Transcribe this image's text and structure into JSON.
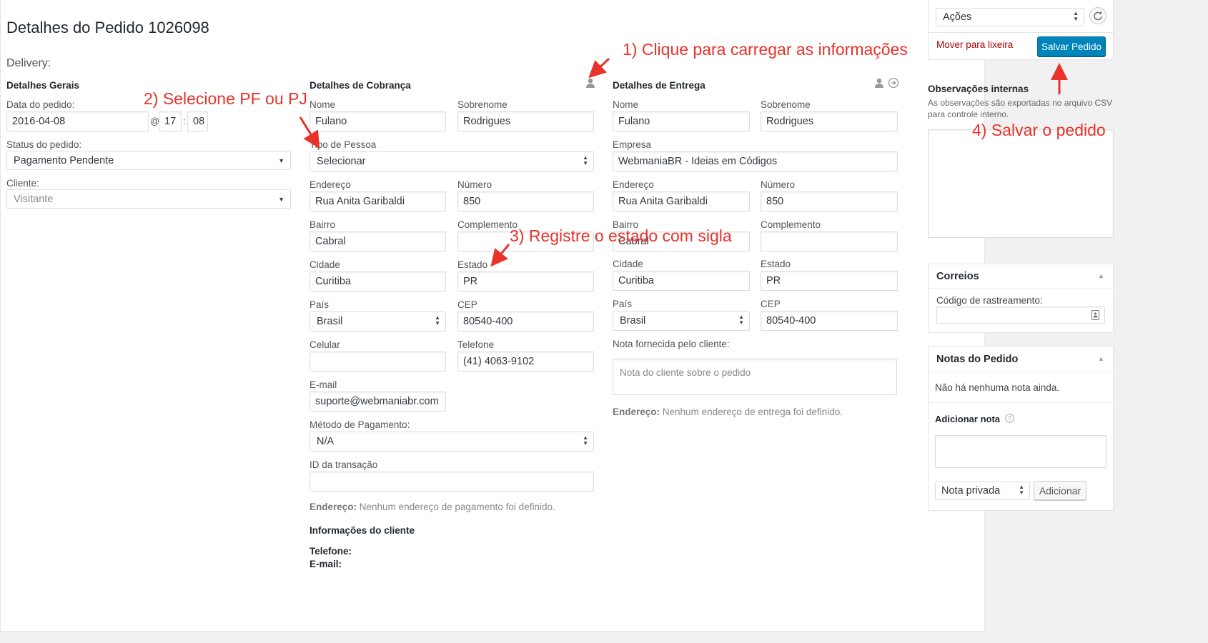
{
  "header": {
    "title": "Detalhes do Pedido 1026098",
    "subtitle": "Delivery:"
  },
  "general": {
    "heading": "Detalhes Gerais",
    "date_label": "Data do pedido:",
    "date_value": "2016-04-08",
    "at_symbol": "@",
    "hour_value": "17",
    "colon": ":",
    "minute_value": "08",
    "status_label": "Status do pedido:",
    "status_value": "Pagamento Pendente",
    "customer_label": "Cliente:",
    "customer_value": "Visitante"
  },
  "billing": {
    "heading": "Detalhes de Cobrança",
    "first_name_label": "Nome",
    "first_name_value": "Fulano",
    "last_name_label": "Sobrenome",
    "last_name_value": "Rodrigues",
    "person_type_label": "Tipo de Pessoa",
    "person_type_value": "Selecionar",
    "address_label": "Endereço",
    "address_value": "Rua Anita Garibaldi",
    "number_label": "Número",
    "number_value": "850",
    "neighborhood_label": "Bairro",
    "neighborhood_value": "Cabral",
    "complement_label": "Complemento",
    "complement_value": "",
    "city_label": "Cidade",
    "city_value": "Curitiba",
    "state_label": "Estado",
    "state_value": "PR",
    "country_label": "País",
    "country_value": "Brasil",
    "zip_label": "CEP",
    "zip_value": "80540-400",
    "cell_label": "Celular",
    "cell_value": "",
    "phone_label": "Telefone",
    "phone_value": "(41) 4063-9102",
    "email_label": "E-mail",
    "email_value": "suporte@webmaniabr.com",
    "payment_label": "Método de Pagamento:",
    "payment_value": "N/A",
    "transaction_label": "ID da transação",
    "transaction_value": "",
    "address_note_bold": "Endereço:",
    "address_note": " Nenhum endereço de pagamento foi definido.",
    "client_info_heading": "Informações do cliente",
    "client_phone_label": "Telefone:",
    "client_email_label": "E-mail:"
  },
  "shipping": {
    "heading": "Detalhes de Entrega",
    "first_name_label": "Nome",
    "first_name_value": "Fulano",
    "last_name_label": "Sobrenome",
    "last_name_value": "Rodrigues",
    "company_label": "Empresa",
    "company_value": "WebmaniaBR - Ideias em Códigos",
    "address_label": "Endereço",
    "address_value": "Rua Anita Garibaldi",
    "number_label": "Número",
    "number_value": "850",
    "neighborhood_label": "Bairro",
    "neighborhood_value": "Cabral",
    "complement_label": "Complemento",
    "complement_value": "",
    "city_label": "Cidade",
    "city_value": "Curitiba",
    "state_label": "Estado",
    "state_value": "PR",
    "country_label": "País",
    "country_value": "Brasil",
    "zip_label": "CEP",
    "zip_value": "80540-400",
    "customer_note_label": "Nota fornecida pelo cliente:",
    "customer_note_placeholder": "Nota do cliente sobre o pedido",
    "address_note_bold": "Endereço:",
    "address_note": " Nenhum endereço de entrega foi definido."
  },
  "annotations": {
    "step1": "1) Clique para carregar as informações",
    "step2": "2) Selecione PF ou PJ",
    "step3": "3) Registre o estado com sigla",
    "step4": "4) Salvar o pedido"
  },
  "sidebar": {
    "actions_value": "Ações",
    "trash_link": "Mover para lixeira",
    "save_button": "Salvar Pedido",
    "internal_notes_heading": "Observações internas",
    "internal_notes_desc_line1": "As observações são exportadas no arquivo CSV",
    "internal_notes_desc_line2": "para controle interno.",
    "correios_title": "Correios",
    "tracking_label": "Código de rastreamento:",
    "tracking_value": "",
    "order_notes_title": "Notas do Pedido",
    "no_notes": "Não há nenhuma nota ainda.",
    "add_note_label": "Adicionar nota",
    "note_type_value": "Nota privada",
    "add_button": "Adicionar"
  },
  "colors": {
    "accent": "#0085ba",
    "annotation": "#e8322a",
    "trash": "#a00"
  }
}
